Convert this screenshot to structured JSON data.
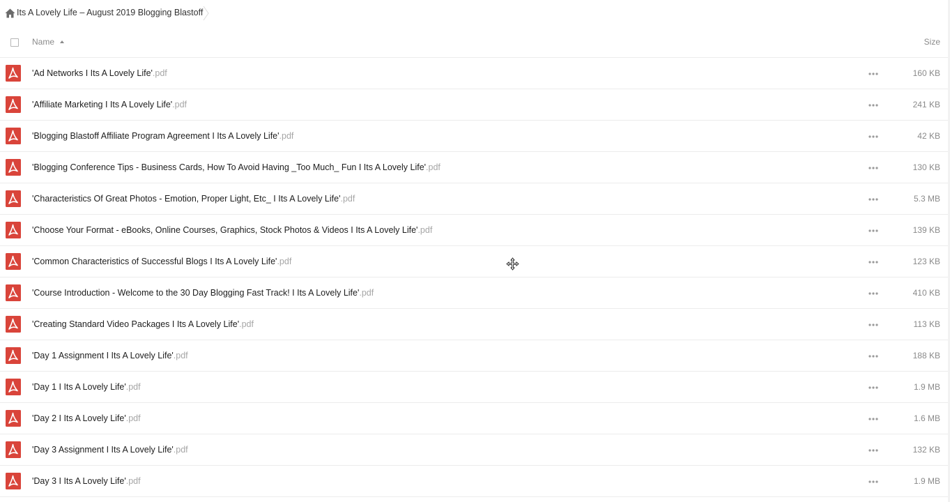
{
  "breadcrumb": {
    "title": "Its A Lovely Life – August 2019 Blogging Blastoff",
    "home_icon": "home-icon"
  },
  "header": {
    "name_label": "Name",
    "size_label": "Size"
  },
  "files": [
    {
      "name": "'Ad Networks I Its A Lovely Life'",
      "ext": ".pdf",
      "size": "160 KB"
    },
    {
      "name": "'Affiliate Marketing I Its A Lovely Life'",
      "ext": ".pdf",
      "size": "241 KB"
    },
    {
      "name": "'Blogging Blastoff Affiliate Program Agreement I Its A Lovely Life'",
      "ext": ".pdf",
      "size": "42 KB"
    },
    {
      "name": "'Blogging Conference Tips - Business Cards, How To Avoid Having _Too Much_ Fun I Its A Lovely Life'",
      "ext": ".pdf",
      "size": "130 KB"
    },
    {
      "name": "'Characteristics Of Great Photos - Emotion, Proper Light, Etc_ I Its A Lovely Life'",
      "ext": ".pdf",
      "size": "5.3 MB"
    },
    {
      "name": "'Choose Your Format - eBooks, Online Courses, Graphics, Stock Photos & Videos I Its A Lovely Life'",
      "ext": ".pdf",
      "size": "139 KB"
    },
    {
      "name": "'Common Characteristics of Successful Blogs I Its A Lovely Life'",
      "ext": ".pdf",
      "size": "123 KB"
    },
    {
      "name": "'Course Introduction - Welcome to the 30 Day Blogging Fast Track! I Its A Lovely Life'",
      "ext": ".pdf",
      "size": "410 KB"
    },
    {
      "name": "'Creating Standard Video Packages I Its A Lovely Life'",
      "ext": ".pdf",
      "size": "113 KB"
    },
    {
      "name": "'Day 1 Assignment I Its A Lovely Life'",
      "ext": ".pdf",
      "size": "188 KB"
    },
    {
      "name": "'Day 1 I Its A Lovely Life'",
      "ext": ".pdf",
      "size": "1.9 MB"
    },
    {
      "name": "'Day 2 I Its A Lovely Life'",
      "ext": ".pdf",
      "size": "1.6 MB"
    },
    {
      "name": "'Day 3 Assignment I Its A Lovely Life'",
      "ext": ".pdf",
      "size": "132 KB"
    },
    {
      "name": "'Day 3 I Its A Lovely Life'",
      "ext": ".pdf",
      "size": "1.9 MB"
    }
  ],
  "colors": {
    "pdf_red": "#d9443a",
    "text": "#1d1d1d",
    "muted": "#8a8a8a"
  }
}
